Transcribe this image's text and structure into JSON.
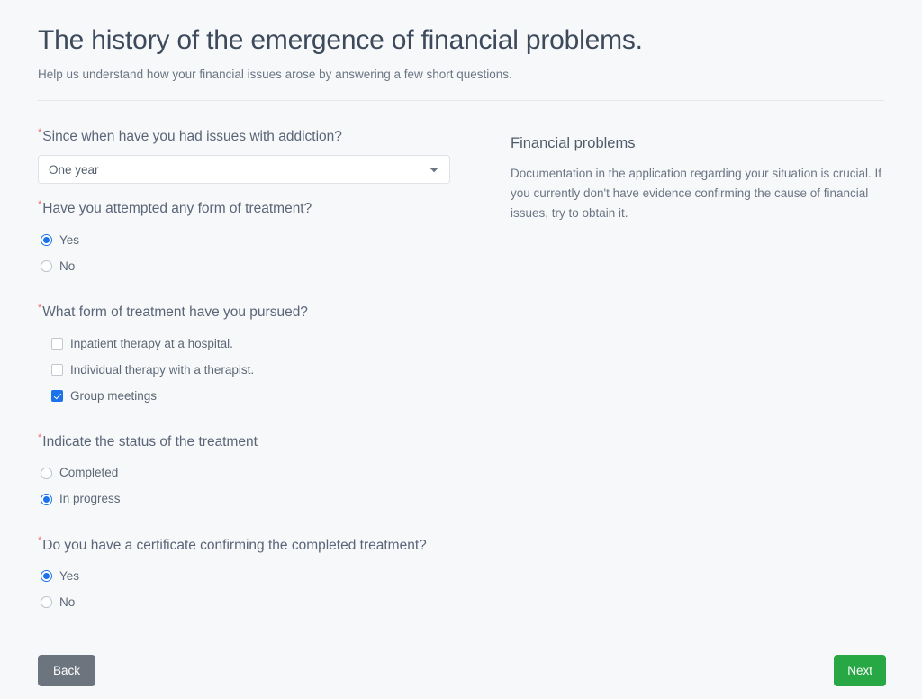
{
  "header": {
    "title": "The history of the emergence of financial problems.",
    "subtitle": "Help us understand how your financial issues arose by answering a few short questions.",
    "required_marker": "*"
  },
  "form": {
    "q1": {
      "label": "Since when have you had issues with addiction?",
      "selected": "One year",
      "options": [
        "One year"
      ]
    },
    "q2": {
      "label": "Have you attempted any form of treatment?",
      "options": [
        {
          "label": "Yes",
          "checked": true
        },
        {
          "label": "No",
          "checked": false
        }
      ]
    },
    "q3": {
      "label": "What form of treatment have you pursued?",
      "options": [
        {
          "label": "Inpatient therapy at a hospital.",
          "checked": false
        },
        {
          "label": "Individual therapy with a therapist.",
          "checked": false
        },
        {
          "label": "Group meetings",
          "checked": true
        }
      ]
    },
    "q4": {
      "label": "Indicate the status of the treatment",
      "options": [
        {
          "label": "Completed",
          "checked": false
        },
        {
          "label": "In progress",
          "checked": true
        }
      ]
    },
    "q5": {
      "label": "Do you have a certificate confirming the completed treatment?",
      "options": [
        {
          "label": "Yes",
          "checked": true
        },
        {
          "label": "No",
          "checked": false
        }
      ]
    }
  },
  "info_panel": {
    "title": "Financial problems",
    "body": "Documentation in the application regarding your situation is crucial. If you currently don't have evidence confirming the cause of financial issues, try to obtain it."
  },
  "footer": {
    "back_label": "Back",
    "next_label": "Next"
  },
  "colors": {
    "background": "#f7f8fa",
    "accent_blue": "#1a73e8",
    "required_red": "#ef6c62",
    "back_gray": "#6c757d",
    "next_green": "#28a745",
    "title_text": "#3d4a5c",
    "body_text": "#6b7684"
  }
}
